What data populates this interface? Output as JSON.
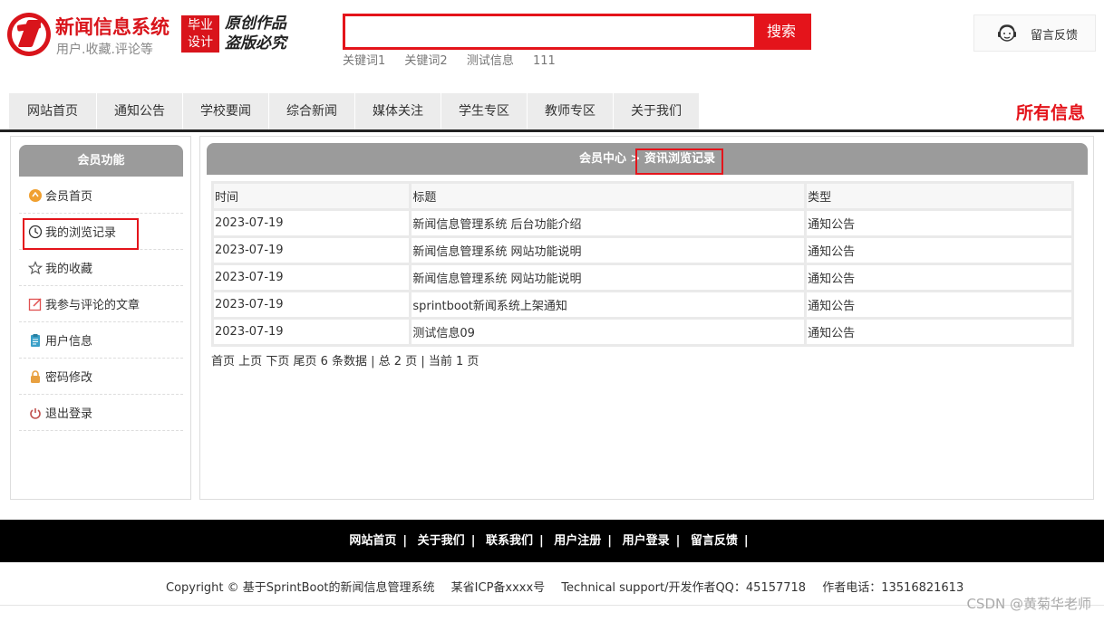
{
  "header": {
    "logo_title": "新闻信息系统",
    "logo_subtitle": "用户.收藏.评论等",
    "badge_line1": "毕业",
    "badge_line2": "设计",
    "slogan_line1": "原创作品",
    "slogan_line2": "盗版必究",
    "search": {
      "value": "",
      "button_label": "搜索"
    },
    "hot_keywords": [
      "关键词1",
      "关键词2",
      "测试信息",
      "111"
    ],
    "feedback_label": "留言反馈"
  },
  "nav": {
    "items": [
      "网站首页",
      "通知公告",
      "学校要闻",
      "综合新闻",
      "媒体关注",
      "学生专区",
      "教师专区",
      "关于我们"
    ],
    "all_info": "所有信息"
  },
  "sidebar": {
    "title": "会员功能",
    "items": [
      {
        "label": "会员首页",
        "icon": "member-home-icon"
      },
      {
        "label": "我的浏览记录",
        "icon": "history-clock-icon"
      },
      {
        "label": "我的收藏",
        "icon": "star-icon"
      },
      {
        "label": "我参与评论的文章",
        "icon": "edit-comment-icon"
      },
      {
        "label": "用户信息",
        "icon": "user-info-icon"
      },
      {
        "label": "密码修改",
        "icon": "lock-icon"
      },
      {
        "label": "退出登录",
        "icon": "power-icon"
      }
    ]
  },
  "main": {
    "breadcrumb_parent": "会员中心",
    "breadcrumb_sep": ">",
    "breadcrumb_current": "资讯浏览记录",
    "table": {
      "headers": [
        "时间",
        "标题",
        "类型"
      ],
      "rows": [
        [
          "2023-07-19",
          "新闻信息管理系统 后台功能介绍",
          "通知公告"
        ],
        [
          "2023-07-19",
          "新闻信息管理系统 网站功能说明",
          "通知公告"
        ],
        [
          "2023-07-19",
          "新闻信息管理系统 网站功能说明",
          "通知公告"
        ],
        [
          "2023-07-19",
          "sprintboot新闻系统上架通知",
          "通知公告"
        ],
        [
          "2023-07-19",
          "测试信息09",
          "通知公告"
        ]
      ]
    },
    "pager": {
      "first": "首页",
      "prev": "上页",
      "next": "下页",
      "last": "尾页",
      "summary": "6 条数据 | 总 2 页 | 当前 1 页"
    }
  },
  "footer": {
    "links": [
      "网站首页",
      "关于我们",
      "联系我们",
      "用户注册",
      "用户登录",
      "留言反馈"
    ],
    "copyright": "Copyright © 基于SprintBoot的新闻信息管理系统",
    "icp": "某省ICP备xxxx号",
    "support": "Technical support/开发作者QQ：45157718",
    "phone": "作者电话：13516821613",
    "watermark": "CSDN @黄菊华老师"
  },
  "colors": {
    "accent": "#e4141b",
    "header_gray": "#9b9b9b",
    "nav_bg": "#ececec"
  }
}
